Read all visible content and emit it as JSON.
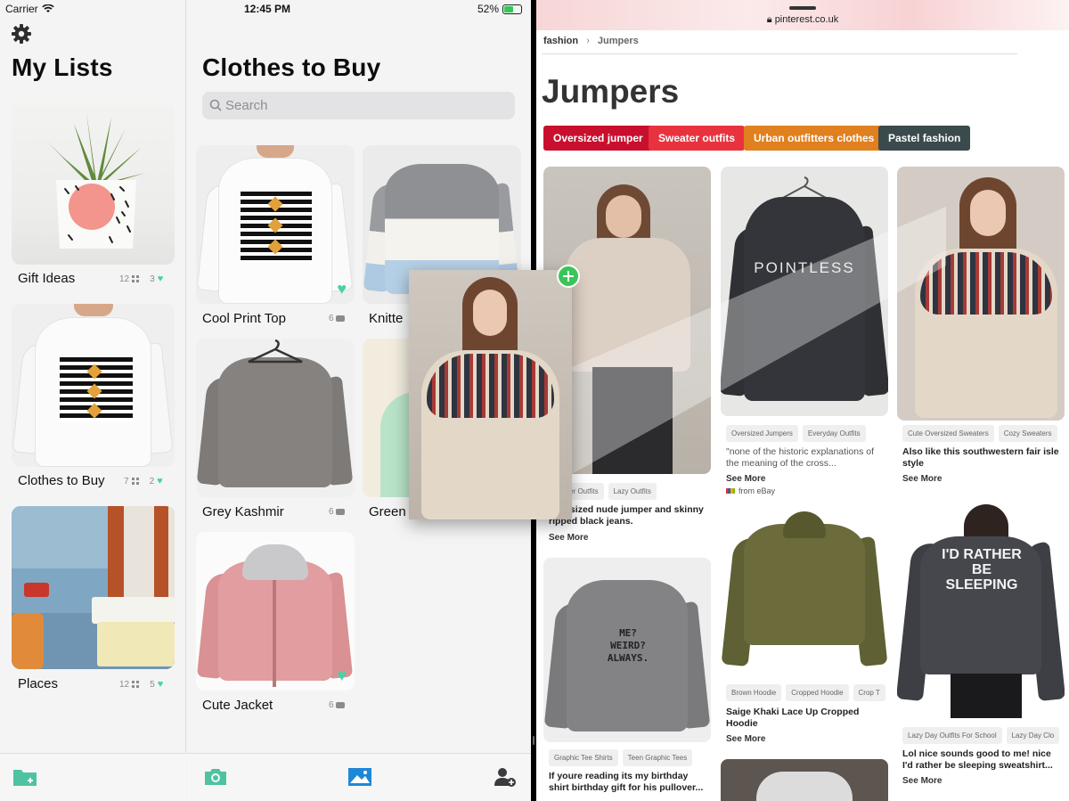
{
  "status": {
    "carrier": "Carrier",
    "time": "12:45 PM",
    "battery": "52%"
  },
  "lists": {
    "title": "My Lists",
    "items": [
      {
        "name": "Gift Ideas",
        "count": "12",
        "likes": "3"
      },
      {
        "name": "Clothes to Buy",
        "count": "7",
        "likes": "2"
      },
      {
        "name": "Places",
        "count": "12",
        "likes": "5"
      }
    ]
  },
  "clothes": {
    "title": "Clothes to Buy",
    "search_placeholder": "Search",
    "items": [
      {
        "name": "Cool Print Top",
        "count": "6"
      },
      {
        "name": "Knitte",
        "count": ""
      },
      {
        "name": "Grey Kashmir",
        "count": "6"
      },
      {
        "name": "Green",
        "count": ""
      },
      {
        "name": "Cute Jacket",
        "count": "6"
      }
    ]
  },
  "browser": {
    "url": "pinterest.co.uk",
    "breadcrumb": [
      "fashion",
      "Jumpers"
    ],
    "page_title": "Jumpers",
    "pills": [
      {
        "label": "Oversized jumper",
        "color": "#c8102e"
      },
      {
        "label": "Sweater outfits",
        "color": "#e8333f"
      },
      {
        "label": "Urban outfitters clothes",
        "color": "#e0801f"
      },
      {
        "label": "Pastel fashion",
        "color": "#3a4a4d"
      }
    ],
    "pins": [
      {
        "tags": [
          "Summer Outfits",
          "Lazy Outfits"
        ],
        "desc": "Oversized nude jumper and skinny ripped black jeans.",
        "see_more": "See More"
      },
      {
        "tags": [
          "Oversized Jumpers",
          "Everyday Outfits"
        ],
        "desc": "\"none of the historic explanations of the meaning of the cross...",
        "see_more": "See More",
        "source": "from eBay"
      },
      {
        "tags": [
          "Cute Oversized Sweaters",
          "Cozy Sweaters"
        ],
        "desc": "Also like this southwestern fair isle style",
        "see_more": "See More"
      },
      {
        "tags": [
          "Graphic Tee Shirts",
          "Teen Graphic Tees"
        ],
        "desc": "If youre reading its my birthday shirt birthday gift for his pullover...",
        "see_more": "See More"
      },
      {
        "tags": [
          "Brown Hoodie",
          "Cropped Hoodie",
          "Crop T"
        ],
        "desc": "Saige Khaki Lace Up Cropped Hoodie",
        "see_more": "See More"
      },
      {
        "tags": [
          "Lazy Day Outfits For School",
          "Lazy Day Clo"
        ],
        "desc": "Lol nice sounds good to me! nice I'd rather be sleeping sweatshirt...",
        "see_more": "See More"
      }
    ],
    "shirt_texts": {
      "pointless": "POINTLESS",
      "weird": "ME?\nWEIRD?\nALWAYS.",
      "sleeping": "I'D RATHER\nBE\nSLEEPING"
    }
  },
  "colors": {
    "accent_green": "#48d1a8",
    "tab_blue": "#1e88d8",
    "add_green": "#3ac55a"
  }
}
